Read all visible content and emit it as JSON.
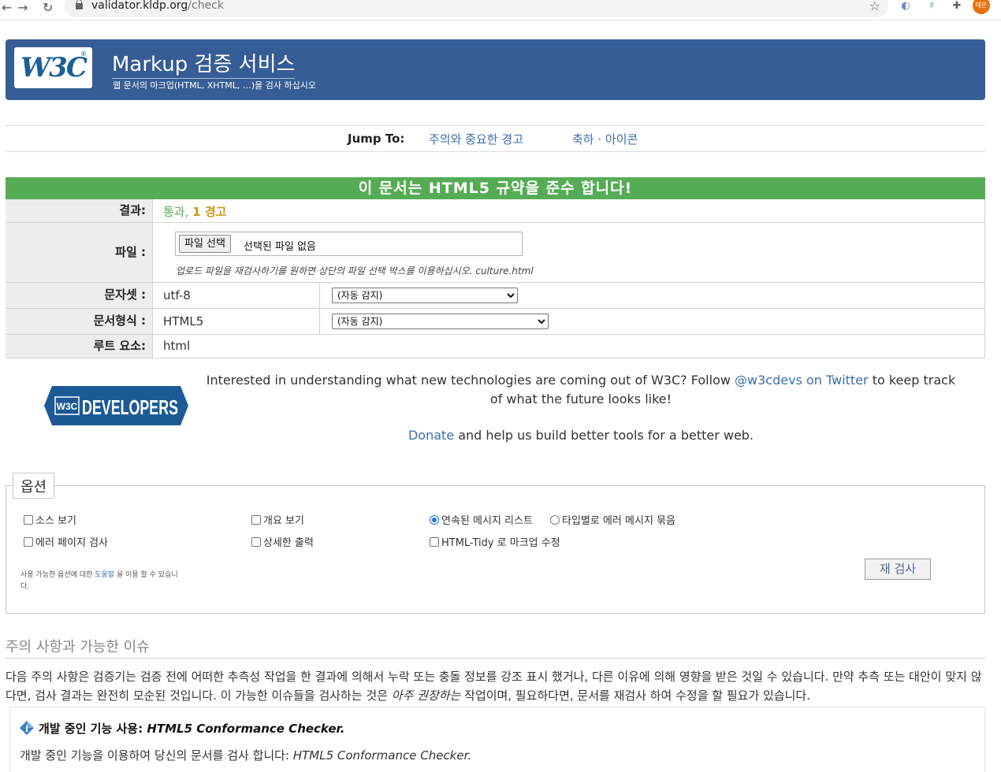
{
  "browser": {
    "url_host": "validator.kldp.org",
    "url_path": "/check",
    "avatar_label": "태은"
  },
  "header": {
    "logo_text": "W3C",
    "title": "Markup 검증 서비스",
    "subtitle": "웹 문서의 마크업(HTML, XHTML, …)을 검사 하십시오"
  },
  "jump": {
    "label": "Jump To:",
    "links": [
      "주의와 중요한 경고",
      "축하 · 아이콘"
    ]
  },
  "result": {
    "banner": "이 문서는 HTML5 규약을 준수 합니다!",
    "rows": {
      "result_label": "결과:",
      "result_pass": "통과,",
      "result_warn": "1 경고",
      "file_label": "파일 :",
      "file_button": "파일 선택",
      "file_none": "선택된 파일 없음",
      "file_note": "업로드 파일을 재검사하기를 원하면 상단의 파일 선택 박스를 이용하십시오. culture.html",
      "charset_label": "문자셋 :",
      "charset_value": "utf-8",
      "charset_select": "(자동 감지)",
      "doctype_label": "문서형식 :",
      "doctype_value": "HTML5",
      "doctype_select": "(자동 감지)",
      "root_label": "루트 요소:",
      "root_value": "html"
    }
  },
  "promo": {
    "logo_text": "DEVELOPERS",
    "text_before": "Interested in understanding what new technologies are coming out of W3C? Follow ",
    "link": "@w3cdevs on Twitter",
    "text_after": " to keep track of what the future looks like!",
    "donate_link": "Donate",
    "donate_text": " and help us build better tools for a better web."
  },
  "options": {
    "legend": "옵션",
    "show_source": "소스 보기",
    "show_outline": "개요 보기",
    "sequential": "연속된 메시지 리스트",
    "group_by_type": "타입별로 에러 메시지 묶음",
    "validate_error_pages": "에러 페이지 검사",
    "verbose": "상세한 출력",
    "html_tidy": "HTML-Tidy 로 마크업 수정",
    "help_before": "사용 가능한 옵션에 대한 ",
    "help_link": "도움말",
    "help_after": " 을 이용 할 수 있습니다.",
    "recheck": "재 검사"
  },
  "notes": {
    "heading": "주의 사항과 가능한 이슈",
    "p_before": "다음 주의 사항은 검증기는 검증 전에 어떠한 추측성 작업을 한 결과에 의해서 누락 또는 충돌 정보를 강조 표시 했거나, 다른 이유에 의해 영향을 받은 것일 수 있습니다. 만약 추측 또는 대안이 맞지 않다면, 검사 결과는 완전히 모순된 것입니다. 이 가능한 이슈들을 검사하는 것은 ",
    "p_em": "아주 권장하는",
    "p_after": " 작업이며, 필요하다면, 문서를 재검사 하여 수정을 할 필요가 있습니다.",
    "card_title": "개발 중인 기능 사용:",
    "card_title_em": "HTML5 Conformance Checker.",
    "card_text": "개발 중인 기능을 이용하여 당신의 문서를 검사 합니다:",
    "card_text_em": "HTML5 Conformance Checker."
  }
}
